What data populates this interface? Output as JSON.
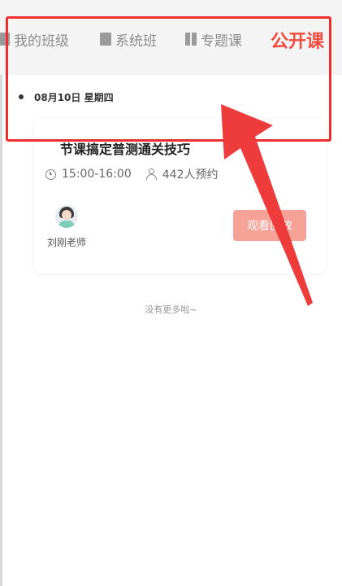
{
  "tabs": [
    {
      "label": "我的班级",
      "icon": "document-icon"
    },
    {
      "label": "系统班",
      "icon": "book-icon"
    },
    {
      "label": "专题课",
      "icon": "open-book-icon"
    }
  ],
  "active_tab": {
    "label": "公开课"
  },
  "date_label": "08月10日 星期四",
  "course": {
    "title": "节课搞定普测通关技巧",
    "time": "15:00-16:00",
    "reservations": "442人预约",
    "teacher": "刘刚老师",
    "button_label": "观看回放"
  },
  "footer_text": "没有更多啦~",
  "annotation": {
    "box_color": "#ee2f2f",
    "arrow_color": "#ee3b3b"
  },
  "colors": {
    "accent": "#f04b3c",
    "button": "#f6a296"
  }
}
